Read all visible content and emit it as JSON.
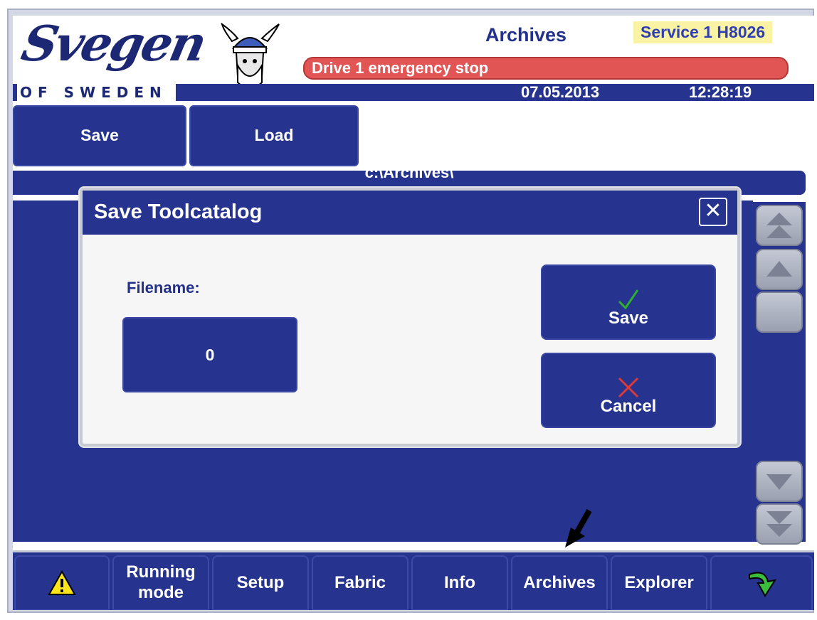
{
  "header": {
    "brand": "Svegen",
    "brand_sub": "OF SWEDEN",
    "page_title": "Archives",
    "service": "Service 1 H8026",
    "alarm": "Drive 1 emergency stop",
    "date": "07.05.2013",
    "time": "12:28:19"
  },
  "toolbar": {
    "save_label": "Save",
    "load_label": "Load"
  },
  "path": "c:\\Archives\\",
  "dialog": {
    "title": "Save Toolcatalog",
    "close_icon": "close-icon",
    "filename_label": "Filename:",
    "filename_value": "0",
    "save_label": "Save",
    "cancel_label": "Cancel",
    "save_icon_color": "#2fae2f",
    "cancel_icon_color": "#d83a3a"
  },
  "nav": {
    "items": [
      {
        "label": "",
        "icon": "warning-icon"
      },
      {
        "label": "Running\nmode"
      },
      {
        "label": "Setup"
      },
      {
        "label": "Fabric"
      },
      {
        "label": "Info"
      },
      {
        "label": "Archives"
      },
      {
        "label": "Explorer"
      },
      {
        "label": "",
        "icon": "return-arrow-icon"
      }
    ]
  },
  "colors": {
    "panel_blue": "#26338f",
    "alarm_red": "#e25555",
    "service_bg": "#fbf3a4",
    "title_blue": "#23318d"
  }
}
